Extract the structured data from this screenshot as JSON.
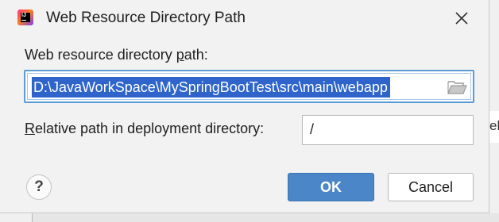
{
  "window": {
    "title": "Web Resource Directory Path",
    "app_icon": "intellij-idea-icon",
    "close_icon": "close-icon"
  },
  "form": {
    "path_label_before": "Web resource directory ",
    "path_label_mnemonic": "p",
    "path_label_after": "ath:",
    "path_value": "D:\\JavaWorkSpace\\MySpringBootTest\\src\\main\\webapp",
    "browse_icon": "folder-open-icon",
    "relative_label_mnemonic": "R",
    "relative_label_after": "elative path in deployment directory:",
    "relative_value": "/"
  },
  "buttons": {
    "help_label": "?",
    "ok_label": "OK",
    "cancel_label": "Cancel"
  },
  "background": {
    "right_fragment": "el"
  },
  "colors": {
    "accent": "#4a86c8",
    "selection": "#2f65ca",
    "focus_border": "#5b9bd5"
  }
}
